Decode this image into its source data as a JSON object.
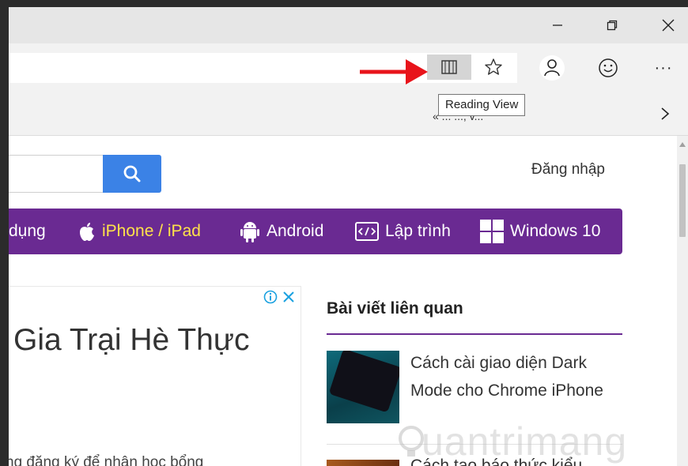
{
  "window": {
    "minimize_icon": "minimize-icon",
    "restore_icon": "restore-icon",
    "close_icon": "close-icon"
  },
  "toolbar": {
    "reading_view_tooltip": "Reading View",
    "more_label": "···"
  },
  "favorites": {
    "item_text": "« ...  ..., v...",
    "next_icon": "chevron-right-icon"
  },
  "page": {
    "login": "Đăng nhập",
    "nav": [
      {
        "label": "dụng",
        "color": "#ffffff"
      },
      {
        "label": "iPhone / iPad",
        "color": "#ffe24a"
      },
      {
        "label": "Android",
        "color": "#ffffff"
      },
      {
        "label": "Lập trình",
        "color": "#ffffff"
      },
      {
        "label": "Windows 10",
        "color": "#ffffff"
      }
    ],
    "ad": {
      "title": "Gia Trại Hè Thực",
      "subtitle": "ng đăng ký để nhận học bổng"
    },
    "related": {
      "title": "Bài viết liên quan",
      "articles": [
        {
          "title": "Cách cài giao diện Dark Mode cho Chrome iPhone"
        },
        {
          "title": "Cách tạo báo thức kiểu"
        }
      ]
    },
    "watermark": "uantrimang"
  },
  "colors": {
    "accent": "#6a2a92",
    "search_button": "#3b82e6",
    "arrow": "#e8141b"
  }
}
